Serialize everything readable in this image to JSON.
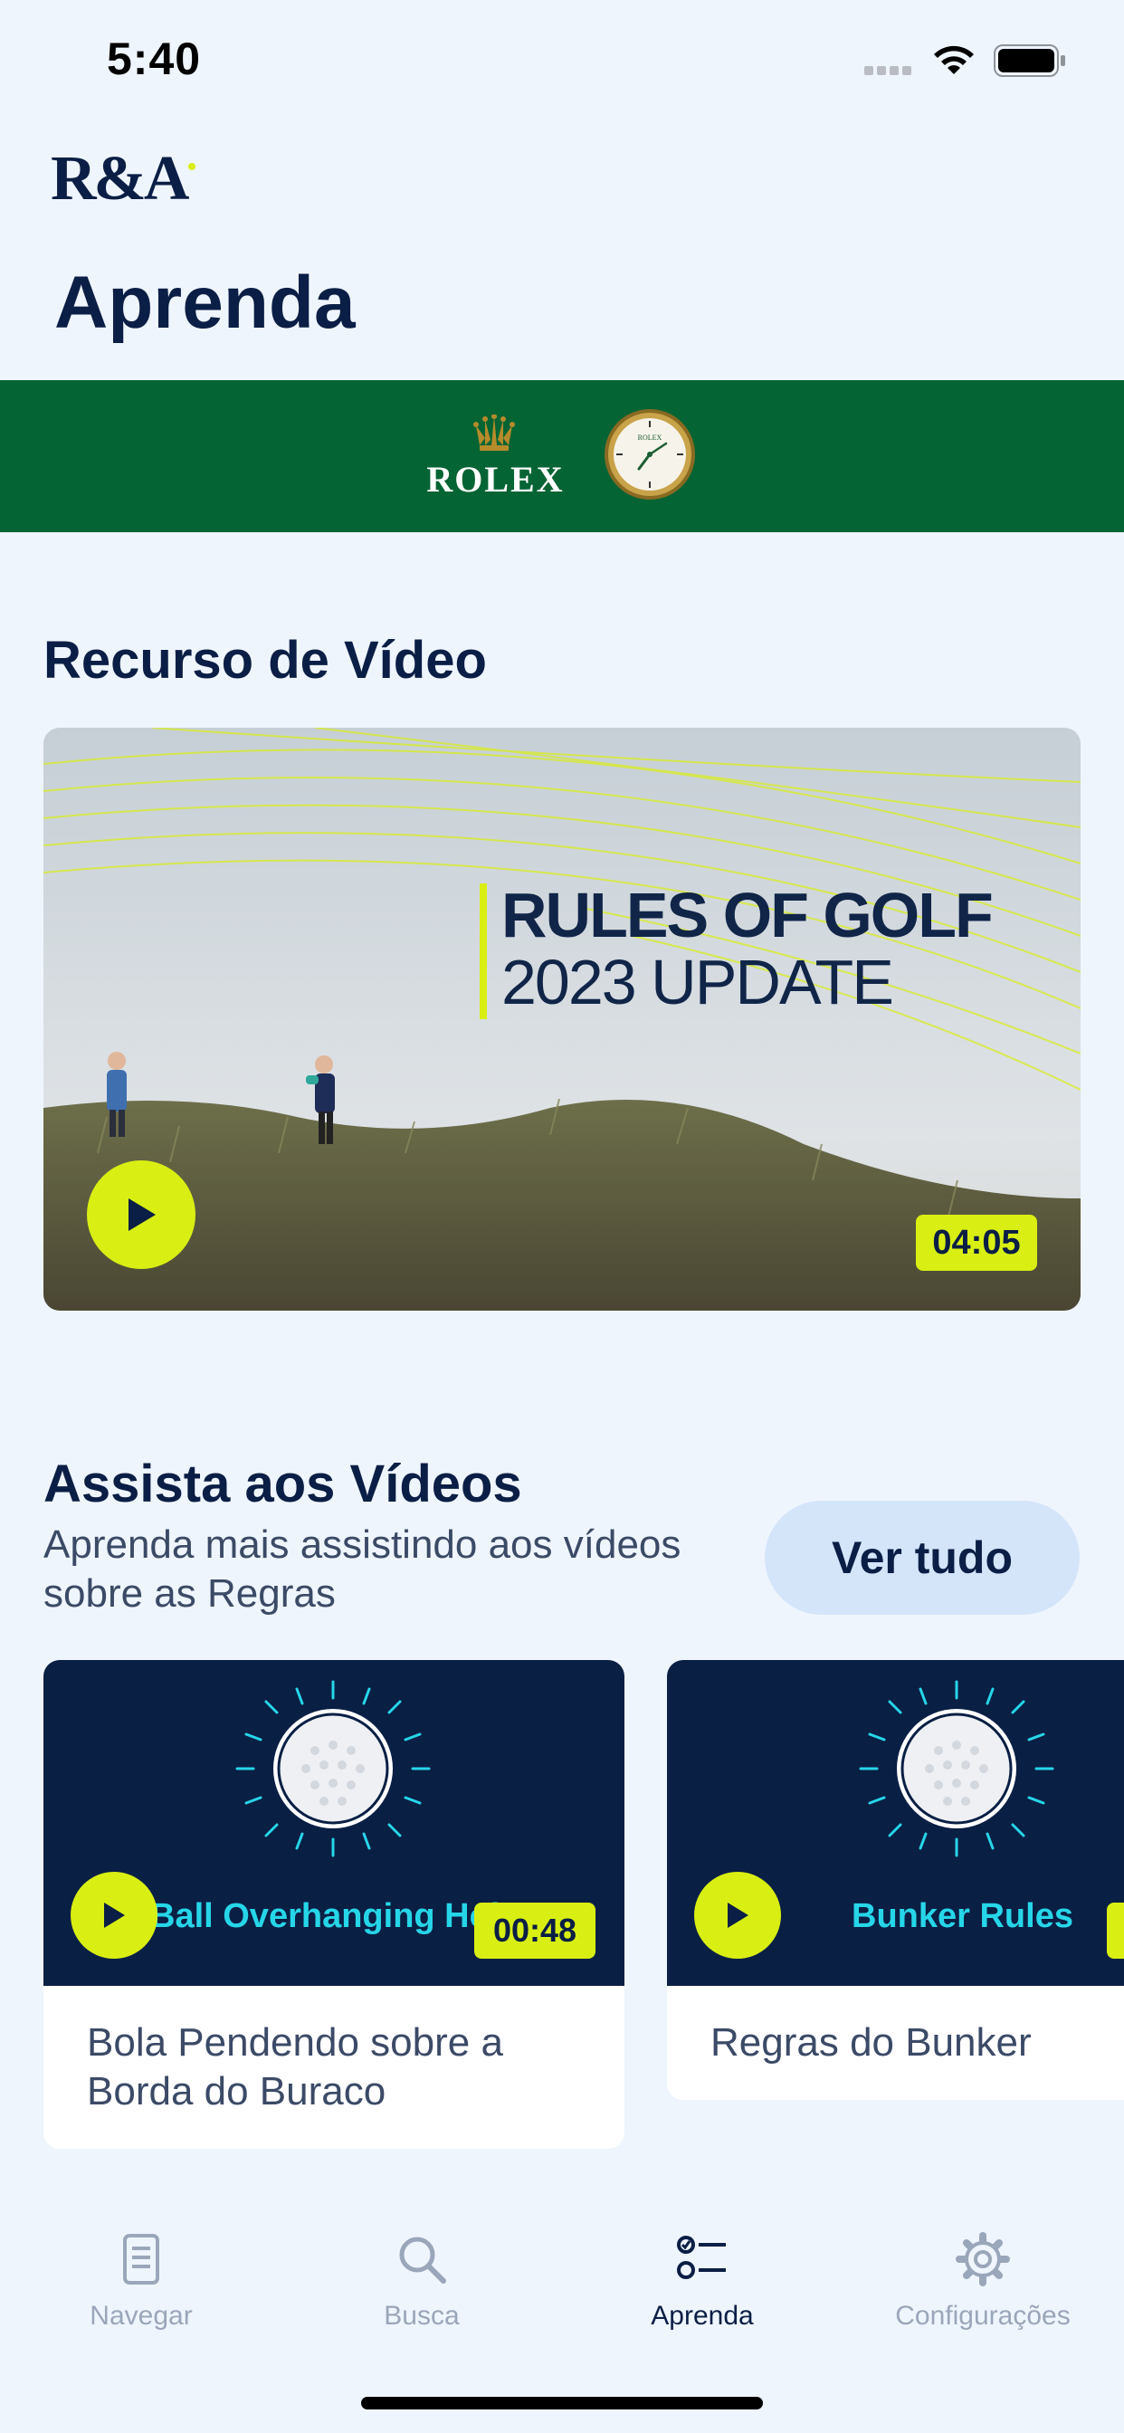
{
  "status_bar": {
    "time": "5:40"
  },
  "header": {
    "logo": "R&A",
    "title": "Aprenda"
  },
  "sponsor": {
    "name": "ROLEX",
    "clock_text": "ROLEX",
    "colors": {
      "banner": "#056433",
      "gold": "#b68b2a"
    }
  },
  "featured": {
    "section_title": "Recurso de Vídeo",
    "headline_line1": "RULES OF GOLF",
    "headline_line2": "2023 UPDATE",
    "duration": "04:05",
    "play_icon": "play-icon"
  },
  "videos": {
    "section_title": "Assista aos Vídeos",
    "section_subtitle": "Aprenda mais assistindo aos vídeos sobre as Regras",
    "see_all_label": "Ver tudo",
    "items": [
      {
        "thumb_label": "Ball Overhanging Hole",
        "duration": "00:48",
        "title": "Bola Pendendo sobre a Borda do Buraco"
      },
      {
        "thumb_label": "Bunker Rules",
        "duration": "",
        "title": "Regras do Bunker"
      }
    ]
  },
  "tab_bar": {
    "tabs": [
      {
        "label": "Navegar",
        "icon": "book-icon",
        "active": false
      },
      {
        "label": "Busca",
        "icon": "search-icon",
        "active": false
      },
      {
        "label": "Aprenda",
        "icon": "checklist-icon",
        "active": true
      },
      {
        "label": "Configurações",
        "icon": "gear-icon",
        "active": false
      }
    ]
  },
  "colors": {
    "accent": "#d9ef13",
    "navy": "#0b1e45",
    "cyan": "#26d6e8",
    "background": "#eff5fd"
  }
}
